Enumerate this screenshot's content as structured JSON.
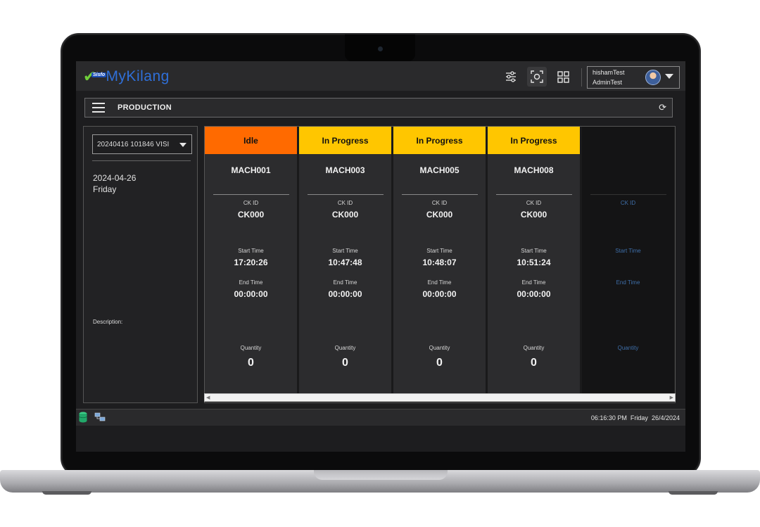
{
  "colors": {
    "idle": "#ff6a00",
    "in_progress": "#ffc600",
    "background": "#1d1d1f",
    "accent": "#2f6fd8"
  },
  "app": {
    "logo_badge": "Sisfo",
    "logo_text": "MyKilang"
  },
  "toolbar": {
    "icons": [
      "sliders-icon",
      "screenshot-icon",
      "grid-icon"
    ]
  },
  "user": {
    "name": "hishamTest",
    "role": "AdminTest"
  },
  "page": {
    "title": "PRODUCTION"
  },
  "sidebar": {
    "selected_job": "20240416 101846 VISI",
    "date": "2024-04-26",
    "day": "Friday",
    "description_label": "Description:"
  },
  "labels": {
    "ck_id": "CK ID",
    "start_time": "Start Time",
    "end_time": "End Time",
    "quantity": "Quantity"
  },
  "machines": [
    {
      "status": "Idle",
      "name": "MACH001",
      "ck_id": "CK000",
      "start_time": "17:20:26",
      "end_time": "00:00:00",
      "quantity": "0"
    },
    {
      "status": "In Progress",
      "name": "MACH003",
      "ck_id": "CK000",
      "start_time": "10:47:48",
      "end_time": "00:00:00",
      "quantity": "0"
    },
    {
      "status": "In Progress",
      "name": "MACH005",
      "ck_id": "CK000",
      "start_time": "10:48:07",
      "end_time": "00:00:00",
      "quantity": "0"
    },
    {
      "status": "In Progress",
      "name": "MACH008",
      "ck_id": "CK000",
      "start_time": "10:51:24",
      "end_time": "00:00:00",
      "quantity": "0"
    }
  ],
  "statusbar": {
    "time": "06:16:30 PM",
    "day": "Friday",
    "date": "26/4/2024"
  }
}
